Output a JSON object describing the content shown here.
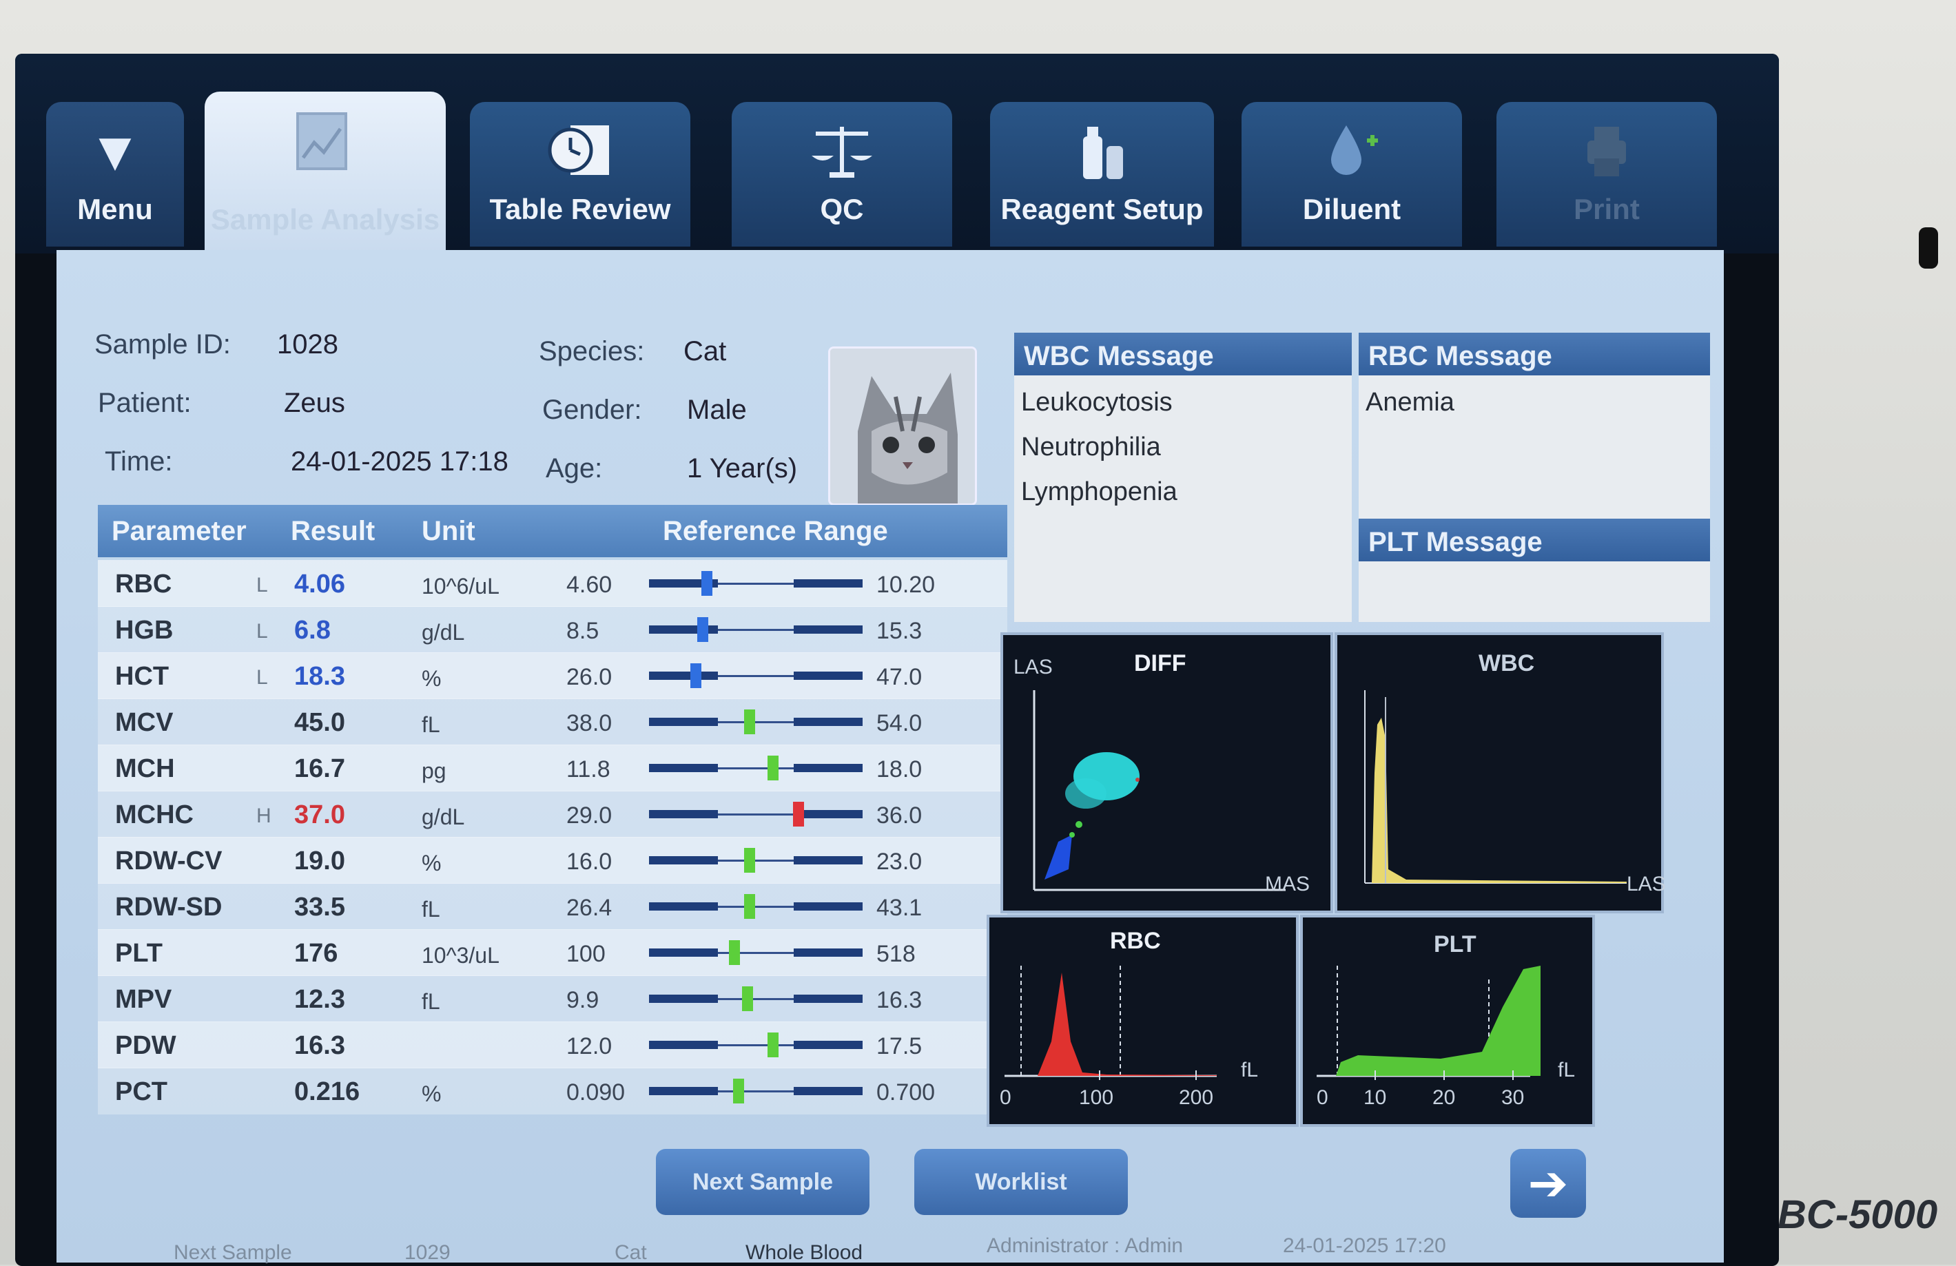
{
  "device": {
    "model": "BC-5000"
  },
  "tabs": [
    {
      "label": "Menu",
      "icon": "menu-triangle-icon"
    },
    {
      "label": "Sample Analysis",
      "icon": "sample-analysis-icon",
      "active": true
    },
    {
      "label": "Table Review",
      "icon": "table-review-icon"
    },
    {
      "label": "QC",
      "icon": "scale-icon"
    },
    {
      "label": "Reagent Setup",
      "icon": "reagent-bottles-icon"
    },
    {
      "label": "Diluent",
      "icon": "diluent-drop-icon"
    },
    {
      "label": "Print",
      "icon": "printer-icon",
      "disabled": true
    }
  ],
  "sample": {
    "id_label": "Sample ID:",
    "id_value": "1028",
    "patient_label": "Patient:",
    "patient_value": "Zeus",
    "time_label": "Time:",
    "time_value": "24-01-2025 17:18",
    "species_label": "Species:",
    "species_value": "Cat",
    "gender_label": "Gender:",
    "gender_value": "Male",
    "age_label": "Age:",
    "age_value": "1 Year(s)"
  },
  "table": {
    "headers": {
      "parameter": "Parameter",
      "result": "Result",
      "unit": "Unit",
      "range": "Reference Range"
    },
    "rows": [
      {
        "param": "RBC",
        "flag": "L",
        "result": "4.06",
        "unit": "10^6/uL",
        "min": "4.60",
        "max": "10.20",
        "status": "low",
        "pos": 0.27
      },
      {
        "param": "HGB",
        "flag": "L",
        "result": "6.8",
        "unit": "g/dL",
        "min": "8.5",
        "max": "15.3",
        "status": "low",
        "pos": 0.25
      },
      {
        "param": "HCT",
        "flag": "L",
        "result": "18.3",
        "unit": "%",
        "min": "26.0",
        "max": "47.0",
        "status": "low",
        "pos": 0.22
      },
      {
        "param": "MCV",
        "flag": "",
        "result": "45.0",
        "unit": "fL",
        "min": "38.0",
        "max": "54.0",
        "status": "normal",
        "pos": 0.47
      },
      {
        "param": "MCH",
        "flag": "",
        "result": "16.7",
        "unit": "pg",
        "min": "11.8",
        "max": "18.0",
        "status": "normal",
        "pos": 0.58
      },
      {
        "param": "MCHC",
        "flag": "H",
        "result": "37.0",
        "unit": "g/dL",
        "min": "29.0",
        "max": "36.0",
        "status": "high",
        "pos": 0.7
      },
      {
        "param": "RDW-CV",
        "flag": "",
        "result": "19.0",
        "unit": "%",
        "min": "16.0",
        "max": "23.0",
        "status": "normal",
        "pos": 0.47
      },
      {
        "param": "RDW-SD",
        "flag": "",
        "result": "33.5",
        "unit": "fL",
        "min": "26.4",
        "max": "43.1",
        "status": "normal",
        "pos": 0.47
      },
      {
        "param": "PLT",
        "flag": "",
        "result": "176",
        "unit": "10^3/uL",
        "min": "100",
        "max": "518",
        "status": "normal",
        "pos": 0.4
      },
      {
        "param": "MPV",
        "flag": "",
        "result": "12.3",
        "unit": "fL",
        "min": "9.9",
        "max": "16.3",
        "status": "normal",
        "pos": 0.46
      },
      {
        "param": "PDW",
        "flag": "",
        "result": "16.3",
        "unit": "",
        "min": "12.0",
        "max": "17.5",
        "status": "normal",
        "pos": 0.58
      },
      {
        "param": "PCT",
        "flag": "",
        "result": "0.216",
        "unit": "%",
        "min": "0.090",
        "max": "0.700",
        "status": "normal",
        "pos": 0.42
      }
    ]
  },
  "messages": {
    "wbc_title": "WBC Message",
    "wbc_items": [
      "Leukocytosis",
      "Neutrophilia",
      "Lymphopenia"
    ],
    "rbc_title": "RBC Message",
    "rbc_items": [
      "Anemia"
    ],
    "plt_title": "PLT Message"
  },
  "histograms": {
    "diff": {
      "title": "DIFF",
      "y_label": "LAS",
      "x_label": "MAS"
    },
    "wbc": {
      "title": "WBC",
      "x_label": "LAS"
    },
    "rbc": {
      "title": "RBC",
      "unit": "fL",
      "ticks": [
        "0",
        "100",
        "200"
      ]
    },
    "plt": {
      "title": "PLT",
      "unit": "fL",
      "ticks": [
        "0",
        "10",
        "20",
        "30"
      ]
    }
  },
  "buttons": {
    "next_sample": "Next Sample",
    "worklist": "Worklist",
    "next_icon": "arrow-right-icon"
  },
  "status": {
    "next_label": "Next Sample",
    "next_id": "1029",
    "next_species": "Cat",
    "next_mode": "Whole Blood",
    "user": "Administrator : Admin",
    "datetime": "24-01-2025 17:20"
  },
  "colors": {
    "low": "#2e58c8",
    "high": "#d0343a",
    "normal_marker": "#5ccf3b",
    "low_marker": "#2f6fe0",
    "high_marker": "#e0343a"
  }
}
